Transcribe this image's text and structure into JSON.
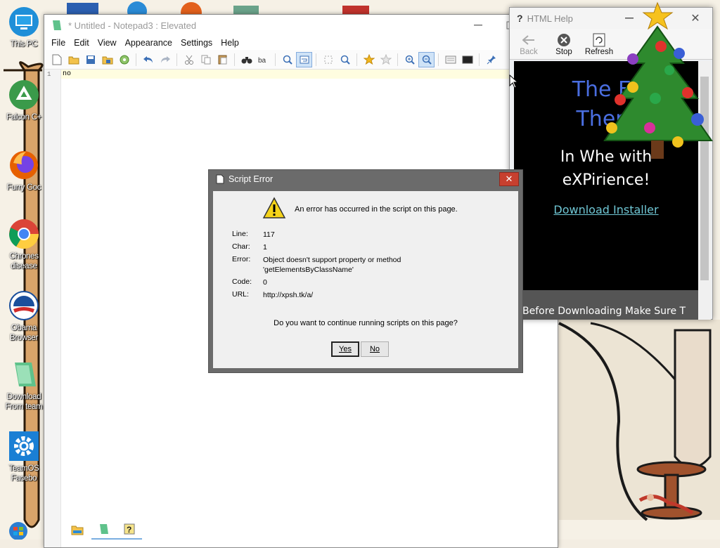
{
  "desktop": {
    "icons": [
      {
        "label": "This PC",
        "icon": "monitor-icon"
      },
      {
        "label": "Falcon C+",
        "icon": "recycle-icon"
      },
      {
        "label": "Furry Goc",
        "icon": "firefox-icon"
      },
      {
        "label": "Chrones disease",
        "icon": "chrome-icon"
      },
      {
        "label": "Obama Browser",
        "icon": "obama-logo-icon"
      },
      {
        "label": "Download From team",
        "icon": "notepad-file-icon"
      },
      {
        "label": "TeamOS Facebo",
        "icon": "gear-icon"
      }
    ]
  },
  "notepad": {
    "title": "* Untitled - Notepad3 : Elevated",
    "menu": [
      "File",
      "Edit",
      "View",
      "Appearance",
      "Settings",
      "Help"
    ],
    "line_number": "1",
    "text": "no"
  },
  "help_window": {
    "title": "HTML Help",
    "tools": [
      "Back",
      "Stop",
      "Refresh"
    ],
    "heading_line1": "The Er",
    "heading_line2": "Them",
    "sub_line1": "In Whe with",
    "sub_line2": "eXPirience!",
    "link": "Download Installer",
    "bottom_text": "Before Downloading Make Sure T"
  },
  "dialog": {
    "title": "Script Error",
    "message": "An error has occurred in the script on this page.",
    "fields": {
      "line_label": "Line:",
      "line_value": "117",
      "char_label": "Char:",
      "char_value": "1",
      "error_label": "Error:",
      "error_value_1": "Object doesn't support property or method",
      "error_value_2": "'getElementsByClassName'",
      "code_label": "Code:",
      "code_value": "0",
      "url_label": "URL:",
      "url_value": "http://xpsh.tk/a/"
    },
    "question": "Do you want to continue running scripts on this page?",
    "yes_label": "Yes",
    "no_label": "No"
  },
  "colors": {
    "dialog_frame": "#6b6b6b",
    "close_button": "#c7402f",
    "help_heading": "#4a6ee0",
    "help_link": "#6fc6d4"
  }
}
